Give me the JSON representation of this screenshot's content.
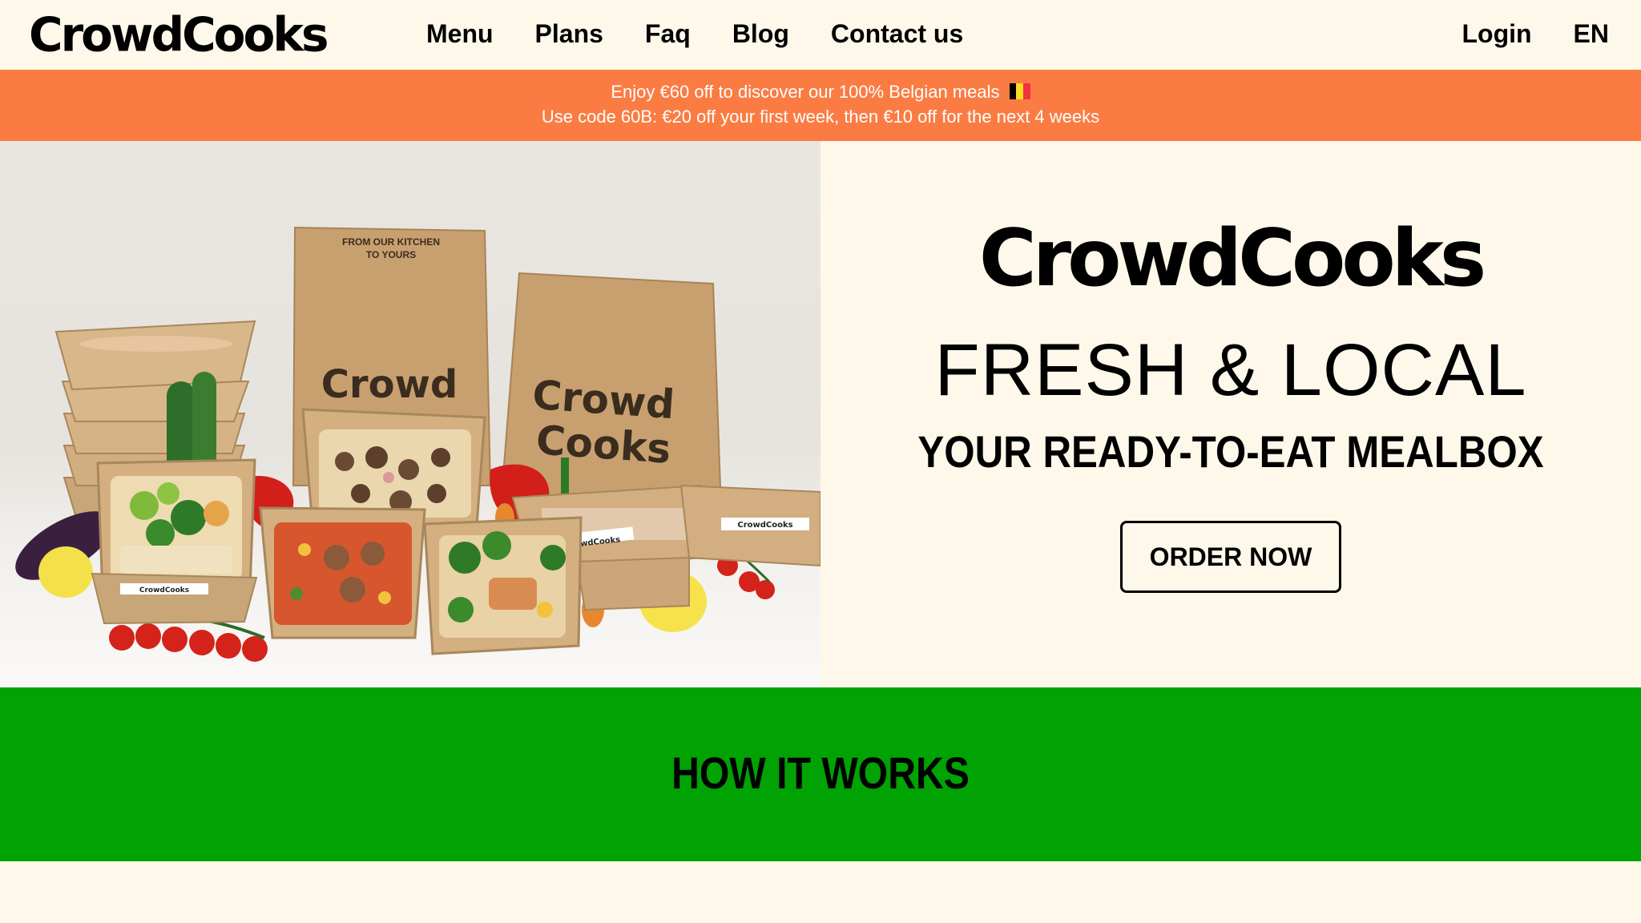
{
  "header": {
    "logo": "CrowdCooks",
    "nav": [
      "Menu",
      "Plans",
      "Faq",
      "Blog",
      "Contact us"
    ],
    "login": "Login",
    "language": "EN"
  },
  "promo": {
    "line1": "Enjoy €60 off to discover our 100% Belgian meals",
    "line2": "Use code 60B: €20 off your first week, then €10 off for the next 4 weeks",
    "flag_colors": [
      "#000000",
      "#fdda24",
      "#ef3340"
    ]
  },
  "hero": {
    "brand": "CrowdCooks",
    "tagline": "FRESH & LOCAL",
    "subtitle": "YOUR READY-TO-EAT MEALBOX",
    "cta": "ORDER NOW",
    "image": {
      "bag_print_top": "FROM OUR KITCHEN",
      "bag_print_bottom": "TO YOURS",
      "bag_brand_1": "Crowd",
      "bag_brand_2": "Cooks",
      "tray_label": "CrowdCooks"
    }
  },
  "how": {
    "title": "HOW IT WORKS"
  },
  "colors": {
    "background": "#fdf8ea",
    "promo": "#fb7c43",
    "green": "#00a303"
  }
}
